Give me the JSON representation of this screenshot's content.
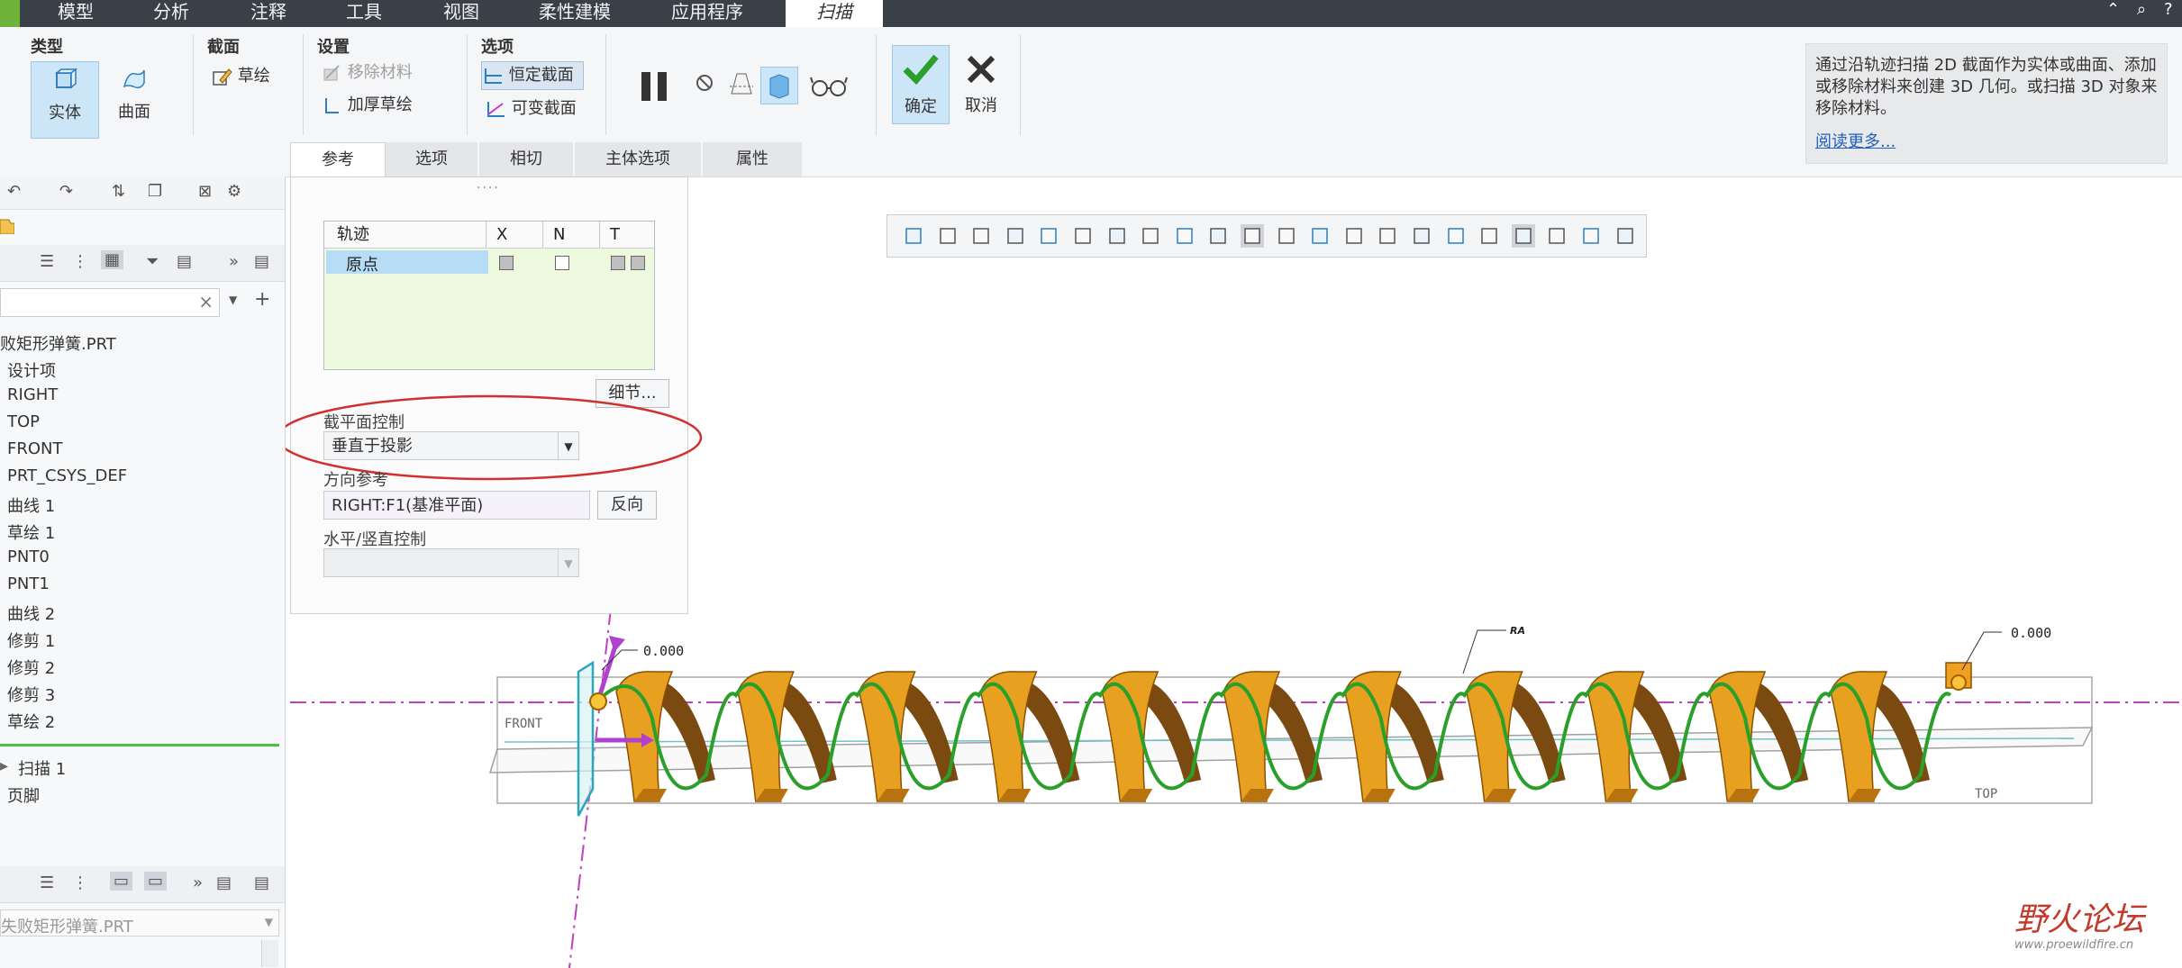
{
  "menubar": {
    "items": [
      "模型",
      "分析",
      "注释",
      "工具",
      "视图",
      "柔性建模",
      "应用程序"
    ],
    "active_tab": "扫描"
  },
  "ribbon": {
    "type_group": {
      "label": "类型",
      "solid": "实体",
      "surface": "曲面"
    },
    "section_group": {
      "label": "截面",
      "sketch": "草绘"
    },
    "settings_group": {
      "label": "设置",
      "remove_material": "移除材料",
      "thicken_sketch": "加厚草绘"
    },
    "options_group": {
      "label": "选项",
      "constant_section": "恒定截面",
      "variable_section": "可变截面"
    },
    "confirm": "确定",
    "cancel": "取消",
    "tabs": [
      "参考",
      "选项",
      "相切",
      "主体选项",
      "属性"
    ]
  },
  "help": {
    "text": "通过沿轨迹扫描 2D 截面作为实体或曲面、添加或移除材料来创建 3D 几何。或扫描 3D 对象来移除材料。",
    "link": "阅读更多..."
  },
  "tree": {
    "root": "败矩形弹簧.PRT",
    "items": [
      "设计项",
      "RIGHT",
      "TOP",
      "FRONT",
      "PRT_CSYS_DEF",
      "曲线 1",
      "草绘 1",
      "PNT0",
      "PNT1",
      "曲线 2",
      "修剪 1",
      "修剪 2",
      "修剪 3",
      "草绘 2"
    ],
    "after_insert": [
      "扫描 1",
      "页脚"
    ],
    "bottom_dropdown": "失败矩形弹簧.PRT"
  },
  "dashboard": {
    "table_headers": [
      "轨迹",
      "X",
      "N",
      "T"
    ],
    "table_row": "原点",
    "detail_button": "细节...",
    "section_plane_label": "截平面控制",
    "section_plane_value": "垂直于投影",
    "direction_ref_label": "方向参考",
    "direction_ref_value": "RIGHT:F1(基准平面)",
    "flip_button": "反向",
    "hv_control_label": "水平/竖直控制",
    "hv_control_value": ""
  },
  "model": {
    "dim_left": "0.000",
    "dim_right": "0.000",
    "ra_label": "RA",
    "front_label": "FRONT",
    "top_label": "TOP"
  },
  "watermark": {
    "brand": "野火论坛",
    "url": "www.proewildfire.cn"
  },
  "colors": {
    "menubar": "#3a4048",
    "accent_green": "#6fb33a",
    "spring_orange": "#e8a020",
    "trajectory_green": "#2aa02a",
    "datum_magenta": "#c040c0",
    "highlight_red": "#d03030"
  }
}
